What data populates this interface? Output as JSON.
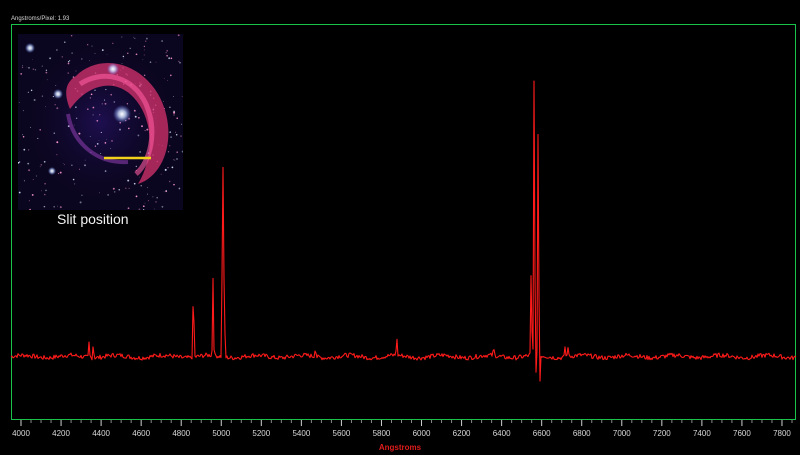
{
  "header": {
    "dispersion_label": "Angstroms/Pixel: 1.93"
  },
  "inset": {
    "caption": "Slit position"
  },
  "colors": {
    "spectrum": "#ff1a1a",
    "frame": "#19c24b",
    "slit": "#f3d21c",
    "background": "#000000"
  },
  "chart_data": {
    "type": "line",
    "xlabel": "Angstroms",
    "ylabel": "",
    "xlim": [
      3950,
      7870
    ],
    "ylim": [
      -0.06,
      1.0
    ],
    "grid": false,
    "xticks": [
      4000,
      4200,
      4400,
      4600,
      4800,
      5000,
      5200,
      5400,
      5600,
      5800,
      6000,
      6200,
      6400,
      6600,
      6800,
      7000,
      7200,
      7400,
      7600,
      7800
    ],
    "continuum_level": 0.11,
    "noise_amplitude": 0.006,
    "series": [
      {
        "lines": [
          {
            "x": 4340,
            "y": 0.15
          },
          {
            "x": 4361,
            "y": 0.15
          },
          {
            "x": 4861,
            "y": 0.32
          },
          {
            "x": 4959,
            "y": 0.32
          },
          {
            "x": 5007,
            "y": 0.78
          },
          {
            "x": 5015,
            "y": 0.35
          },
          {
            "x": 5470,
            "y": 0.14
          },
          {
            "x": 5876,
            "y": 0.16
          },
          {
            "x": 6360,
            "y": 0.13
          },
          {
            "x": 6548,
            "y": 0.36
          },
          {
            "x": 6563,
            "y": 0.99
          },
          {
            "x": 6572,
            "y": 0.06
          },
          {
            "x": 6583,
            "y": 0.83
          },
          {
            "x": 6590,
            "y": 0.02
          },
          {
            "x": 6717,
            "y": 0.14
          },
          {
            "x": 6731,
            "y": 0.14
          }
        ]
      }
    ]
  }
}
